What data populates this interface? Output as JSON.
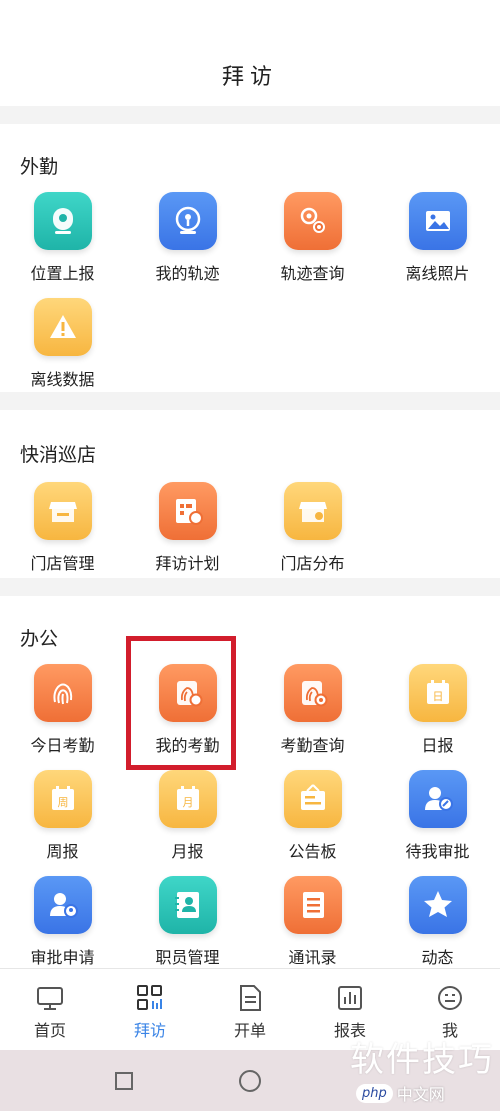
{
  "header": {
    "title": "拜访"
  },
  "sections": {
    "field": {
      "title": "外勤",
      "items": [
        {
          "label": "位置上报",
          "icon": "location-report-icon",
          "color": "teal"
        },
        {
          "label": "我的轨迹",
          "icon": "my-track-icon",
          "color": "blue"
        },
        {
          "label": "轨迹查询",
          "icon": "track-query-icon",
          "color": "orange"
        },
        {
          "label": "离线照片",
          "icon": "offline-photo-icon",
          "color": "blue"
        },
        {
          "label": "离线数据",
          "icon": "offline-data-warning-icon",
          "color": "yellow"
        }
      ]
    },
    "fmcg": {
      "title": "快消巡店",
      "items": [
        {
          "label": "门店管理",
          "icon": "store-management-icon",
          "color": "yellow"
        },
        {
          "label": "拜访计划",
          "icon": "visit-plan-icon",
          "color": "orange"
        },
        {
          "label": "门店分布",
          "icon": "store-distribution-icon",
          "color": "yellow"
        }
      ]
    },
    "office": {
      "title": "办公",
      "items": [
        {
          "label": "今日考勤",
          "icon": "fingerprint-icon",
          "color": "orange"
        },
        {
          "label": "我的考勤",
          "icon": "my-attendance-icon",
          "color": "orange"
        },
        {
          "label": "考勤查询",
          "icon": "attendance-query-icon",
          "color": "orange"
        },
        {
          "label": "日报",
          "icon": "calendar-day-icon",
          "color": "yellow"
        },
        {
          "label": "周报",
          "icon": "calendar-week-icon",
          "color": "yellow"
        },
        {
          "label": "月报",
          "icon": "calendar-month-icon",
          "color": "yellow"
        },
        {
          "label": "公告板",
          "icon": "bulletin-board-icon",
          "color": "yellow"
        },
        {
          "label": "待我审批",
          "icon": "pending-approval-icon",
          "color": "blue"
        },
        {
          "label": "审批申请",
          "icon": "approval-request-icon",
          "color": "blue"
        },
        {
          "label": "职员管理",
          "icon": "staff-management-icon",
          "color": "teal"
        },
        {
          "label": "通讯录",
          "icon": "contacts-icon",
          "color": "orange"
        },
        {
          "label": "动态",
          "icon": "star-icon",
          "color": "blue"
        }
      ],
      "calendar_glyphs": {
        "day": "日",
        "week": "周",
        "month": "月"
      }
    }
  },
  "tabbar": {
    "tabs": [
      {
        "label": "首页",
        "icon": "monitor-icon"
      },
      {
        "label": "拜访",
        "icon": "grid-chart-icon",
        "active": true
      },
      {
        "label": "开单",
        "icon": "document-icon"
      },
      {
        "label": "报表",
        "icon": "bar-chart-icon"
      },
      {
        "label": "我",
        "icon": "smile-face-icon"
      }
    ],
    "active_color": "#3a84e6"
  },
  "watermark": {
    "text": "软件技巧",
    "php": "php",
    "site": "中文网"
  }
}
